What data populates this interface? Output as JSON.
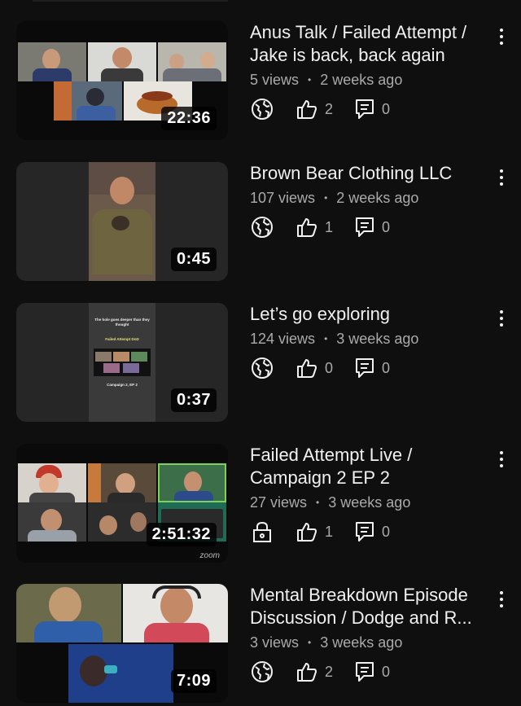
{
  "videos": [
    {
      "title": "Anus Talk / Failed Attempt / Jake is back, back again",
      "views": "5 views",
      "age": "2 weeks ago",
      "duration": "22:36",
      "visibility_icon": "globe-icon",
      "likes": "2",
      "comments": "0"
    },
    {
      "title": "Brown Bear Clothing LLC",
      "views": "107 views",
      "age": "2 weeks ago",
      "duration": "0:45",
      "visibility_icon": "globe-icon",
      "likes": "1",
      "comments": "0"
    },
    {
      "title": "Let’s go exploring",
      "views": "124 views",
      "age": "3 weeks ago",
      "duration": "0:37",
      "visibility_icon": "globe-icon",
      "likes": "0",
      "comments": "0",
      "thumb_text": {
        "line1": "The hole goes deeper than they thought",
        "line2": "Failed Attempt DnD",
        "line3": "Campaign 2, EP 2"
      }
    },
    {
      "title": "Failed Attempt Live / Campaign 2 EP 2",
      "views": "27 views",
      "age": "3 weeks ago",
      "duration": "2:51:32",
      "visibility_icon": "lock-icon",
      "likes": "1",
      "comments": "0",
      "thumb_text": {
        "watermark": "zoom"
      }
    },
    {
      "title": "Mental Breakdown Episode Discussion / Dodge and R...",
      "views": "3 views",
      "age": "3 weeks ago",
      "duration": "7:09",
      "visibility_icon": "globe-icon",
      "likes": "2",
      "comments": "0"
    }
  ],
  "meta_separator": "•",
  "colors": {
    "background": "#0f0f0f",
    "text": "#f1f1f1",
    "secondary_text": "#aaaaaa"
  }
}
